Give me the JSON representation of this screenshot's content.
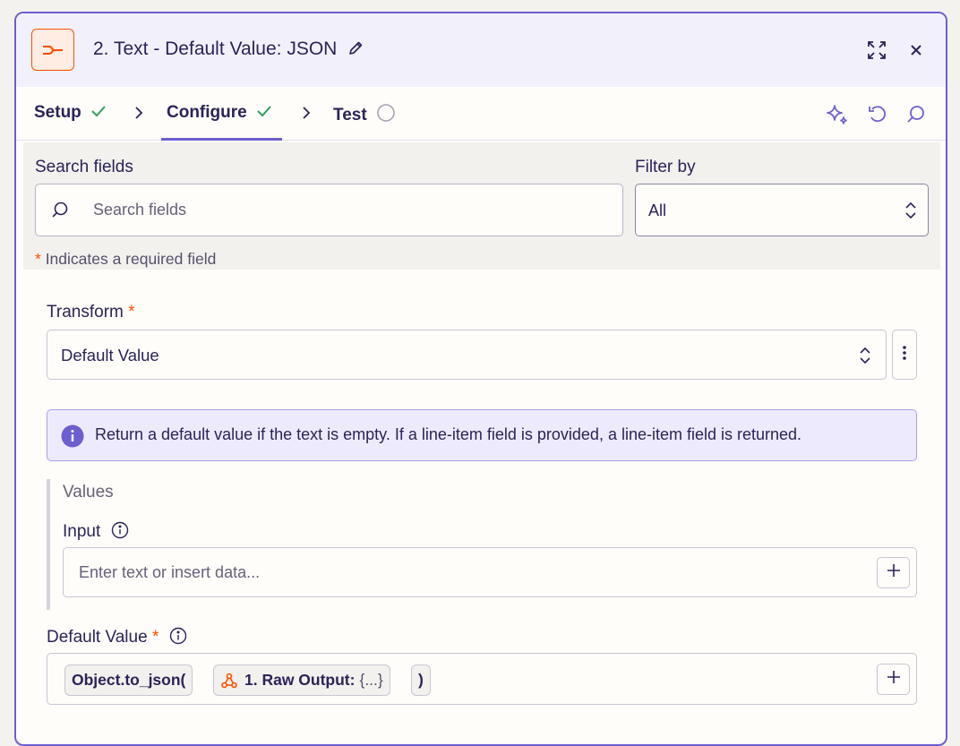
{
  "header": {
    "title": "2. Text - Default Value: JSON",
    "app_icon": "formatter-icon",
    "expand_icon": "expand-icon",
    "close_icon": "close-icon"
  },
  "tabs": [
    {
      "label": "Setup",
      "status": "complete"
    },
    {
      "label": "Configure",
      "status": "complete",
      "active": true
    },
    {
      "label": "Test",
      "status": "pending"
    }
  ],
  "toolbar_icons": [
    "sparkle-icon",
    "undo-icon",
    "search-icon"
  ],
  "search": {
    "label": "Search fields",
    "placeholder": "Search fields",
    "filter_label": "Filter by",
    "filter_value": "All",
    "required_note": "Indicates a required field",
    "required_marker": "*"
  },
  "transform": {
    "label": "Transform",
    "required_marker": "*",
    "value": "Default Value"
  },
  "info": {
    "text": "Return a default value if the text is empty. If a line-item field is provided, a line-item field is returned."
  },
  "values": {
    "section_label": "Values",
    "input_label": "Input",
    "input_placeholder": "Enter text or insert data..."
  },
  "default_value": {
    "label": "Default Value",
    "required_marker": "*",
    "pills": {
      "open": "Object.to_json(",
      "data_label": "1. Raw Output:",
      "data_value": "{...}",
      "close": ")"
    }
  },
  "colors": {
    "accent": "#6d5fd0",
    "brand_orange": "#ff4f00",
    "success": "#2f9e5b"
  }
}
